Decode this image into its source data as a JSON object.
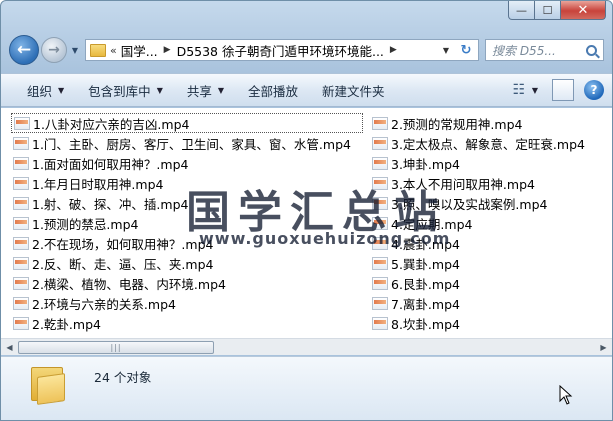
{
  "window": {
    "caption": {
      "minimize": "—",
      "maximize": "☐",
      "close": "✕"
    }
  },
  "address": {
    "prefix": "«",
    "crumbs": [
      "国学...",
      "D5538 徐子朝奇门遁甲环境环境能..."
    ]
  },
  "search": {
    "placeholder": "搜索 D55..."
  },
  "toolbar": {
    "organize": "组织",
    "include_library": "包含到库中",
    "share": "共享",
    "play_all": "全部播放",
    "new_folder": "新建文件夹"
  },
  "files_left": [
    "1.八卦对应六亲的吉凶.mp4",
    "1.门、主卧、厨房、客厅、卫生间、家具、窗、水管.mp4",
    "1.面对面如何取用神？.mp4",
    "1.年月日时取用神.mp4",
    "1.射、破、探、冲、插.mp4",
    "1.预测的禁忌.mp4",
    "2.不在现场，如何取用神？.mp4",
    "2.反、断、走、逼、压、夹.mp4",
    "2.横梁、植物、电器、内环境.mp4",
    "2.环境与六亲的关系.mp4",
    "2.乾卦.mp4"
  ],
  "files_right": [
    "2.预测的常规用神.mp4",
    "3.定太极点、解象意、定旺衰.mp4",
    "3.坤卦.mp4",
    "3.本人不用问取用神.mp4",
    "3.照、嗅以及实战案例.mp4",
    "4.定应期.mp4",
    "4.震卦.mp4",
    "5.巽卦.mp4",
    "6.艮卦.mp4",
    "7.离卦.mp4",
    "8.坎卦.mp4"
  ],
  "watermark": {
    "text": "国学汇总站",
    "url": "www.guoxuehuizong.com"
  },
  "status": {
    "count": "24 个对象"
  }
}
